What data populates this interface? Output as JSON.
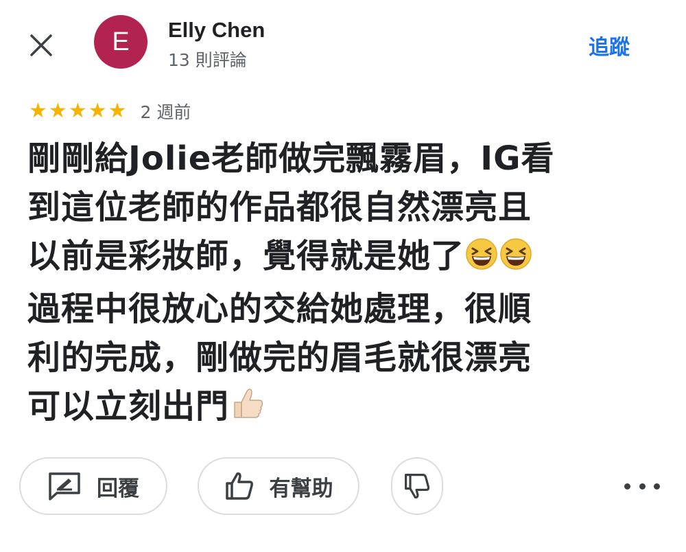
{
  "header": {
    "close_icon": "close-icon",
    "avatar_letter": "E",
    "avatar_color": "#b2234f",
    "author_name": "Elly Chen",
    "review_count": "13 則評論",
    "follow_label": "追蹤",
    "accent_color": "#1a73e8"
  },
  "review": {
    "rating": 5,
    "max_rating": 5,
    "star_color": "#f4b400",
    "time_ago": "2 週前",
    "lines": [
      "剛剛給Jolie老師做完飄霧眉，IG看",
      "到這位老師的作品都很自然漂亮且",
      "以前是彩妝師，覺得就是她了",
      "過程中很放心的交給她處理，很順",
      "利的完成，剛做完的眉毛就很漂亮",
      "可以立刻出門"
    ],
    "emojis": [
      "grinning-squinting-face-emoji",
      "thumbs-up-emoji"
    ]
  },
  "actions": {
    "reply_label": "回覆",
    "helpful_label": "有幫助",
    "reply_icon": "reply-icon",
    "helpful_icon": "thumbs-up-icon",
    "unhelpful_icon": "thumbs-down-icon",
    "more_icon": "more-horizontal-icon"
  }
}
